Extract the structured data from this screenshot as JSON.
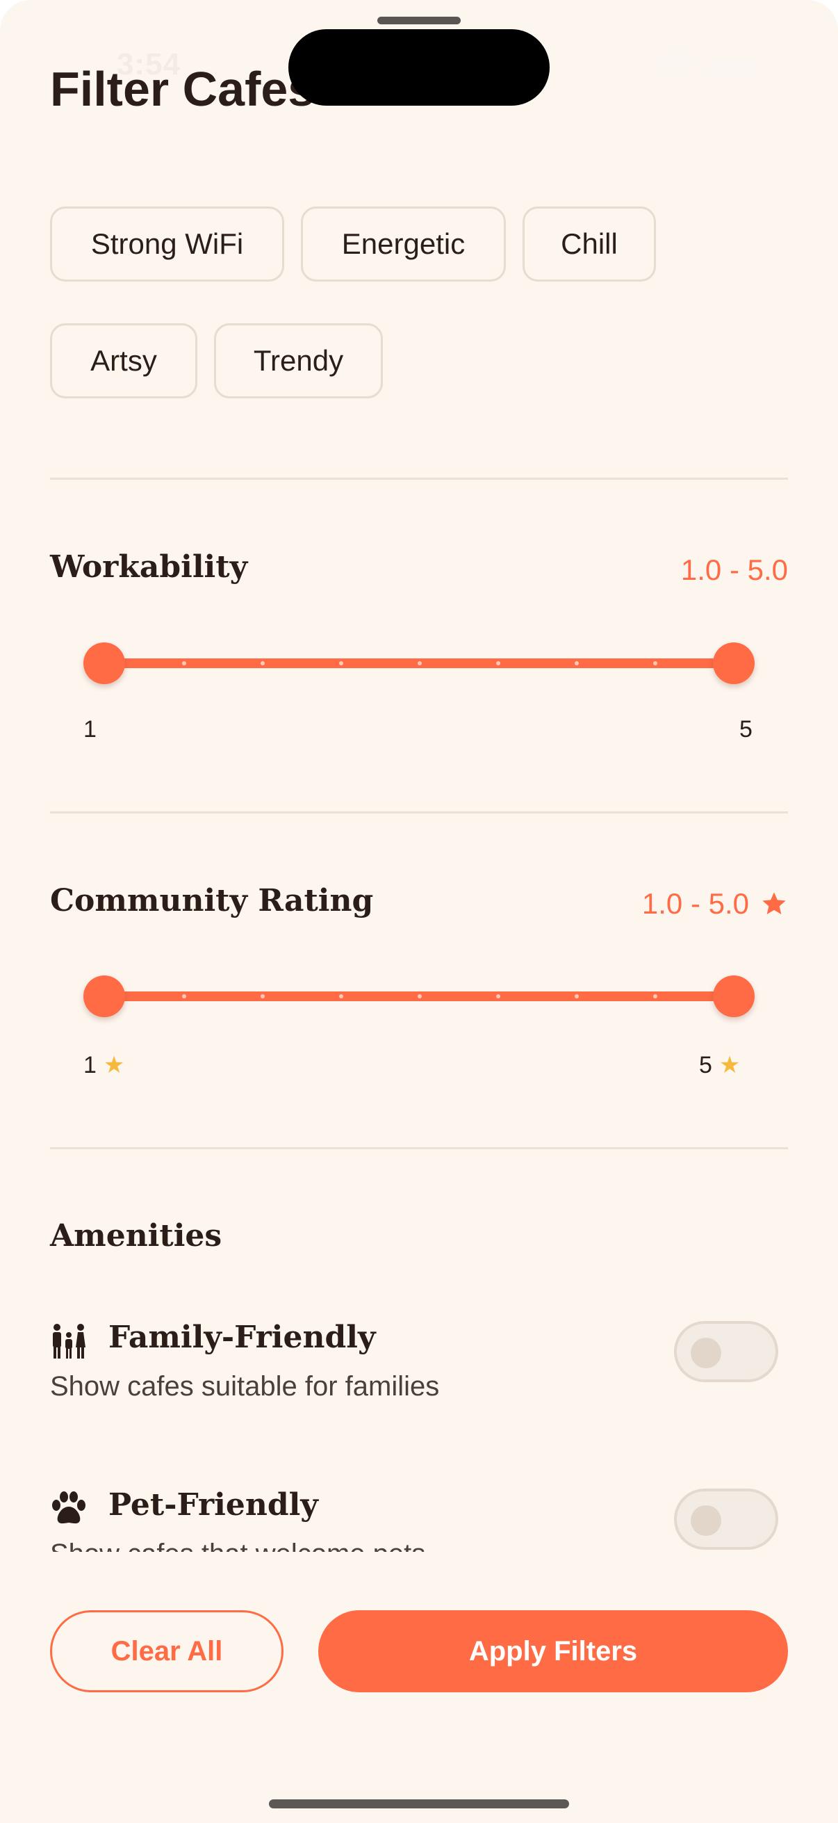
{
  "status_bar": {
    "time": "3:54"
  },
  "header": {
    "title": "Filter Cafes"
  },
  "vibe_chips": [
    "Strong WiFi",
    "Energetic",
    "Chill",
    "Artsy",
    "Trendy"
  ],
  "workability": {
    "title": "Workability",
    "range_label": "1.0 - 5.0",
    "min_label": "1",
    "max_label": "5",
    "selected_min": 1.0,
    "selected_max": 5.0
  },
  "community_rating": {
    "title": "Community Rating",
    "range_label": "1.0 - 5.0",
    "min_label": "1",
    "max_label": "5",
    "selected_min": 1.0,
    "selected_max": 5.0
  },
  "amenities": {
    "title": "Amenities",
    "items": [
      {
        "label": "Family-Friendly",
        "description": "Show cafes suitable for families",
        "enabled": false,
        "icon": "family-icon"
      },
      {
        "label": "Pet-Friendly",
        "description": "Show cafes that welcome pets",
        "enabled": false,
        "icon": "paw-icon"
      }
    ]
  },
  "actions": {
    "clear_label": "Clear All",
    "apply_label": "Apply Filters"
  },
  "colors": {
    "accent": "#fe6b45",
    "background": "#fdf6ef",
    "text": "#2b1d17"
  }
}
